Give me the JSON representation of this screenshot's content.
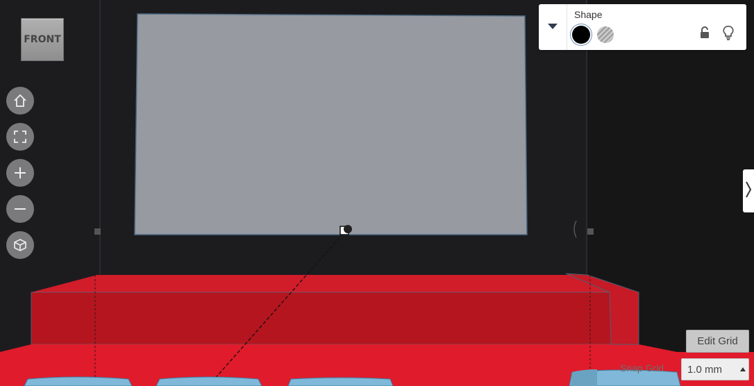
{
  "viewport": {
    "view_cube": {
      "label": "FRONT"
    },
    "nav_buttons": [
      {
        "icon": "home-icon"
      },
      {
        "icon": "fit-view-icon"
      },
      {
        "icon": "zoom-in-icon"
      },
      {
        "icon": "zoom-out-icon"
      },
      {
        "icon": "perspective-icon"
      }
    ]
  },
  "inspector": {
    "title": "Shape",
    "solid_color": "#000000",
    "icons": [
      "chevron-down-icon",
      "lock-icon",
      "bulb-icon"
    ]
  },
  "grid": {
    "edit_label": "Edit Grid",
    "snap_label": "Snap Grid",
    "snap_value": "1.0 mm"
  },
  "colors": {
    "workplane": "#1c1c1e",
    "red_shape": "#e01b2b",
    "grey_shape": "#979aa1",
    "blue_shapes": "#7fb8d8"
  }
}
